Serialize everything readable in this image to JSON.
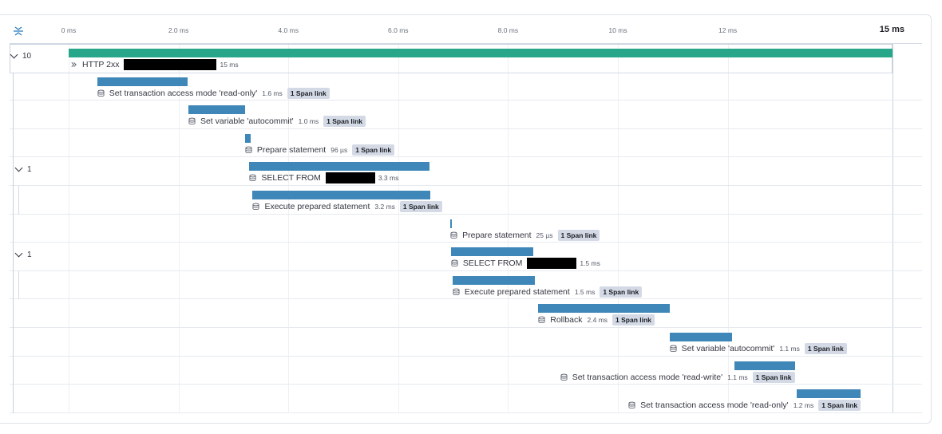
{
  "axis": {
    "ticks": [
      "0 ms",
      "2.0 ms",
      "4.0 ms",
      "6.0 ms",
      "8.0 ms",
      "10 ms",
      "12 ms"
    ],
    "end_label": "15 ms",
    "total_ms": 15
  },
  "colors": {
    "root_bar": "#28a68a",
    "span_bar": "#3f87b8",
    "badge_bg": "#d3dae6"
  },
  "rows": [
    {
      "toggle": "10",
      "name": "HTTP 2xx",
      "duration": "15 ms",
      "link": "",
      "icon": "http-icon",
      "redacted": true,
      "start_ms": 0,
      "dur_ms": 15
    },
    {
      "toggle": "",
      "name": "Set transaction access mode 'read-only'",
      "duration": "1.6 ms",
      "link": "1 Span link",
      "icon": "database-icon",
      "redacted": false,
      "start_ms": 0.52,
      "dur_ms": 1.65
    },
    {
      "toggle": "",
      "name": "Set variable 'autocommit'",
      "duration": "1.0 ms",
      "link": "1 Span link",
      "icon": "database-icon",
      "redacted": false,
      "start_ms": 2.18,
      "dur_ms": 1.03
    },
    {
      "toggle": "",
      "name": "Prepare statement",
      "duration": "96 µs",
      "link": "1 Span link",
      "icon": "database-icon",
      "redacted": false,
      "start_ms": 3.21,
      "dur_ms": 0.1
    },
    {
      "toggle": "1",
      "name": "SELECT FROM",
      "duration": "3.3 ms",
      "link": "",
      "icon": "database-icon",
      "redacted": true,
      "start_ms": 3.29,
      "dur_ms": 3.28
    },
    {
      "toggle": "",
      "name": "Execute prepared statement",
      "duration": "3.2 ms",
      "link": "1 Span link",
      "icon": "database-icon",
      "redacted": false,
      "start_ms": 3.35,
      "dur_ms": 3.24
    },
    {
      "toggle": "",
      "name": "Prepare statement",
      "duration": "25 µs",
      "link": "1 Span link",
      "icon": "database-icon",
      "redacted": false,
      "start_ms": 6.95,
      "dur_ms": 0.03
    },
    {
      "toggle": "1",
      "name": "SELECT FROM",
      "duration": "1.5 ms",
      "link": "",
      "icon": "database-icon",
      "redacted": true,
      "start_ms": 6.96,
      "dur_ms": 1.5
    },
    {
      "toggle": "",
      "name": "Execute prepared statement",
      "duration": "1.5 ms",
      "link": "1 Span link",
      "icon": "database-icon",
      "redacted": false,
      "start_ms": 6.99,
      "dur_ms": 1.5
    },
    {
      "toggle": "",
      "name": "Rollback",
      "duration": "2.4 ms",
      "link": "1 Span link",
      "icon": "database-icon",
      "redacted": false,
      "start_ms": 8.55,
      "dur_ms": 2.39
    },
    {
      "toggle": "",
      "name": "Set variable 'autocommit'",
      "duration": "1.1 ms",
      "link": "1 Span link",
      "icon": "database-icon",
      "redacted": false,
      "start_ms": 10.94,
      "dur_ms": 1.14
    },
    {
      "toggle": "",
      "name": "Set transaction access mode 'read-write'",
      "duration": "1.1 ms",
      "link": "1 Span link",
      "icon": "database-icon",
      "redacted": false,
      "start_ms": 12.12,
      "dur_ms": 1.1
    },
    {
      "toggle": "",
      "name": "Set transaction access mode 'read-only'",
      "duration": "1.2 ms",
      "link": "1 Span link",
      "icon": "database-icon",
      "redacted": false,
      "start_ms": 13.25,
      "dur_ms": 1.17
    }
  ]
}
